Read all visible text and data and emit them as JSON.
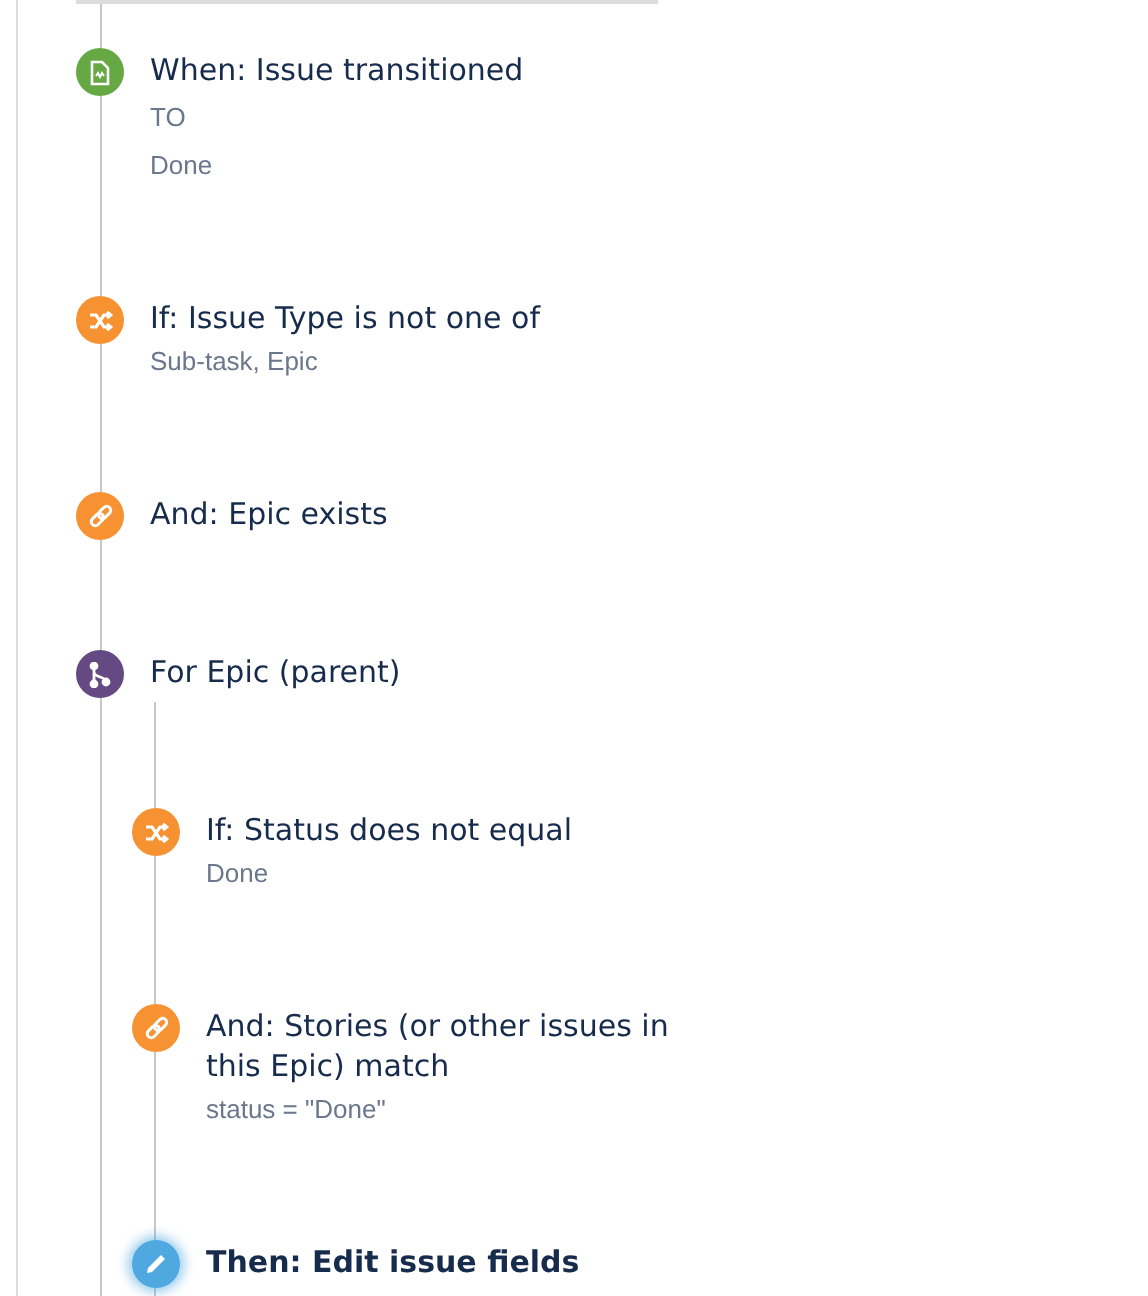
{
  "steps": [
    {
      "kind": "trigger",
      "title": "When: Issue transitioned",
      "details": [
        "TO",
        "Done"
      ],
      "selected": false
    },
    {
      "kind": "condition",
      "title": "If: Issue Type is not one of",
      "details": [
        "Sub-task, Epic"
      ],
      "selected": false
    },
    {
      "kind": "link",
      "title": "And: Epic exists",
      "selected": false
    },
    {
      "kind": "branch",
      "title": "For Epic (parent)",
      "selected": false,
      "children": [
        {
          "kind": "condition",
          "title": "If: Status does not equal",
          "details": [
            "Done"
          ],
          "selected": false
        },
        {
          "kind": "link",
          "title": "And: Stories (or other issues in this Epic) match",
          "details": [
            "status = \"Done\""
          ],
          "selected": false
        },
        {
          "kind": "action",
          "title": "Then: Edit issue fields",
          "selected": true
        }
      ]
    }
  ]
}
